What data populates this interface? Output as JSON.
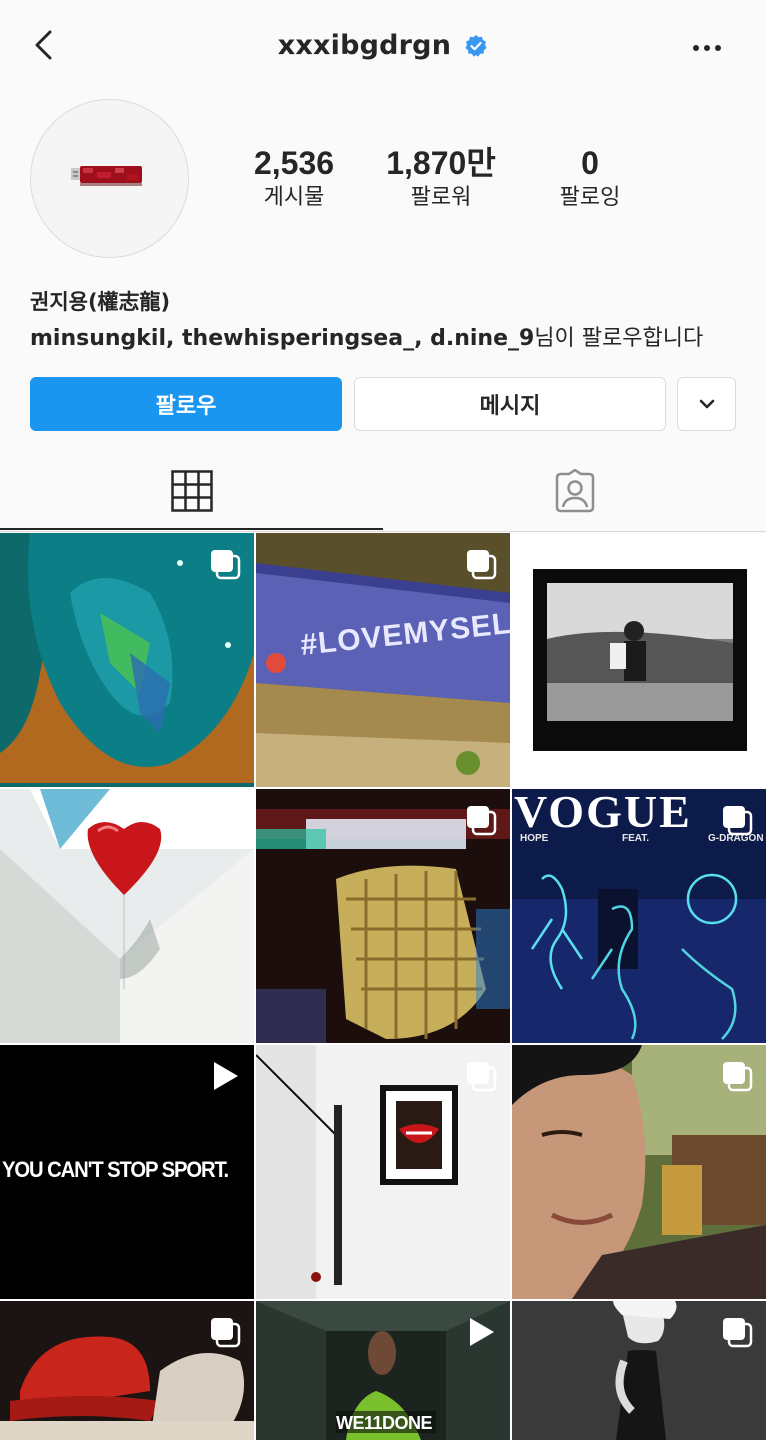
{
  "header": {
    "username": "xxxibgdrgn",
    "back_icon": "chevron-left-icon",
    "verified_icon": "verified-badge-icon",
    "more_icon": "more-horizontal-icon"
  },
  "profile": {
    "avatar_icon": "usb-drive-avatar",
    "display_name": "권지용(權志龍)",
    "followed_by_names": "minsungkil, thewhisperingsea_, d.nine_9",
    "followed_by_suffix": "님이 팔로우합니다"
  },
  "stats": {
    "posts": {
      "value": "2,536",
      "label": "게시물"
    },
    "followers": {
      "value": "1,870만",
      "label": "팔로워"
    },
    "following": {
      "value": "0",
      "label": "팔로잉"
    }
  },
  "actions": {
    "follow_label": "팔로우",
    "message_label": "메시지",
    "dropdown_icon": "chevron-down-icon"
  },
  "tabs": [
    {
      "name": "posts-grid",
      "icon": "grid-icon",
      "active": true
    },
    {
      "name": "tagged",
      "icon": "tagged-person-icon",
      "active": false
    }
  ],
  "posts": [
    {
      "type": "carousel",
      "theme": "teal-surfboard"
    },
    {
      "type": "carousel",
      "theme": "lovemyself-graffiti",
      "text": "#LOVEMYSELF"
    },
    {
      "type": "image",
      "theme": "framed-bw-photo"
    },
    {
      "type": "carousel",
      "theme": "red-heart-balloon"
    },
    {
      "type": "carousel",
      "theme": "checkered-jacket-blur"
    },
    {
      "type": "carousel",
      "theme": "vogue-cover",
      "text": "VOGUE",
      "subtexts": [
        "HOPE",
        "FEAT.",
        "G-DRAGON"
      ]
    },
    {
      "type": "video",
      "theme": "you-cant-stop-sport",
      "text": "YOU CAN'T STOP SPORT."
    },
    {
      "type": "carousel",
      "theme": "smile-frame"
    },
    {
      "type": "carousel",
      "theme": "selfie-portrait"
    },
    {
      "type": "carousel",
      "theme": "red-cap"
    },
    {
      "type": "video",
      "theme": "welldone-corridor",
      "text": "WE11DONE"
    },
    {
      "type": "carousel",
      "theme": "bw-model"
    }
  ],
  "colors": {
    "accent_blue": "#1a96f0",
    "text": "#262626",
    "border": "#dbdbdb",
    "background": "#fafafa"
  }
}
